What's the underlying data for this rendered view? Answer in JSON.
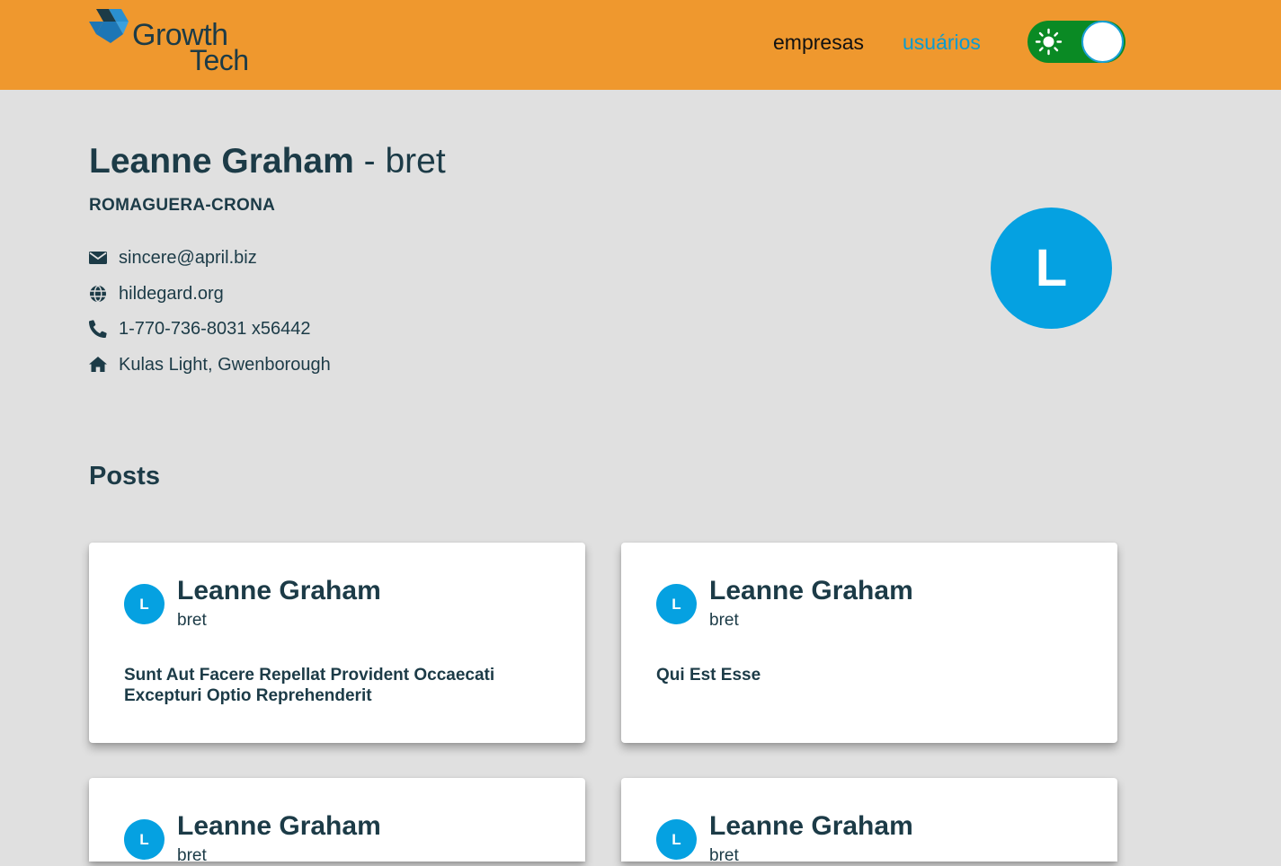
{
  "brand": {
    "word1": "Growth",
    "word2": "Tech"
  },
  "nav": {
    "companies_label": "empresas",
    "users_label": "usuários"
  },
  "theme_toggle": {
    "icon": "sun-icon",
    "state": "light"
  },
  "profile": {
    "name": "Leanne Graham",
    "separator": " - ",
    "username": "bret",
    "company": "ROMAGUERA-CRONA",
    "avatar_letter": "L",
    "contacts": [
      {
        "icon": "envelope-icon",
        "text": "sincere@april.biz"
      },
      {
        "icon": "globe-icon",
        "text": "hildegard.org"
      },
      {
        "icon": "phone-icon",
        "text": "1-770-736-8031 x56442"
      },
      {
        "icon": "home-icon",
        "text": "Kulas Light, Gwenborough"
      }
    ]
  },
  "posts_section": {
    "title": "Posts",
    "posts": [
      {
        "avatar_letter": "L",
        "author": "Leanne Graham",
        "handle": "bret",
        "title": "Sunt Aut Facere Repellat Provident Occaecati Excepturi Optio Reprehenderit"
      },
      {
        "avatar_letter": "L",
        "author": "Leanne Graham",
        "handle": "bret",
        "title": "Qui Est Esse"
      },
      {
        "avatar_letter": "L",
        "author": "Leanne Graham",
        "handle": "bret",
        "title": ""
      },
      {
        "avatar_letter": "L",
        "author": "Leanne Graham",
        "handle": "bret",
        "title": ""
      }
    ]
  },
  "colors": {
    "header_bg": "#ef982e",
    "accent": "#05a1e1",
    "toggle_bg": "#0a8a24",
    "text": "#1c3b47",
    "page_bg": "#e0e0e0"
  }
}
